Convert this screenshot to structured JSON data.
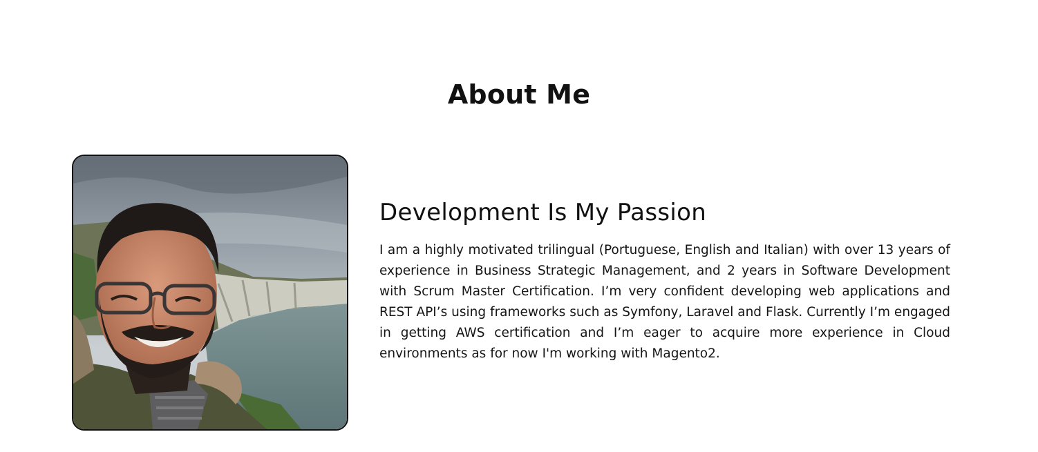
{
  "about": {
    "title": "About Me",
    "subtitle": "Development Is My Passion",
    "bio": "I am a highly motivated trilingual (Portuguese, English and Italian) with over 13 years of experience in Business Strategic Management, and 2 years in Software Development with Scrum Master Certification. I’m very confident developing web applications and REST API’s using frameworks such as Symfony, Laravel and Flask. Currently I’m engaged in getting AWS certification and I’m eager to acquire more experience in Cloud environments as for now I'm working with Magento2."
  },
  "colors": {
    "background": "#ffffff",
    "text": "#111111",
    "photo_border": "#111111"
  }
}
